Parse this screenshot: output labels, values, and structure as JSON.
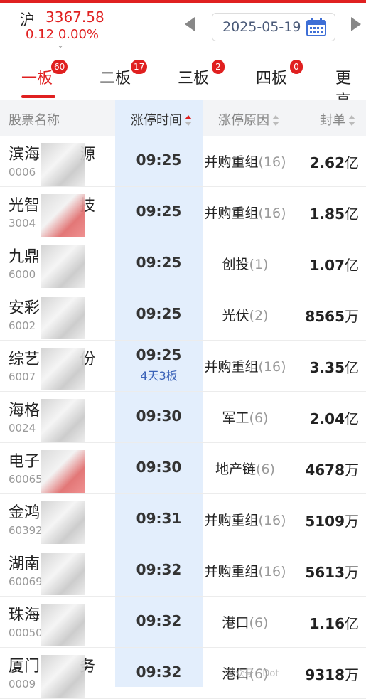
{
  "index": {
    "name": "沪",
    "value": "3367.58",
    "change": "0.12",
    "change_pct": "0.00%",
    "color": "#e02020"
  },
  "date": {
    "value": "2025-05-19"
  },
  "tabs": [
    {
      "label": "一板",
      "badge": "60",
      "active": true
    },
    {
      "label": "二板",
      "badge": "17"
    },
    {
      "label": "三板",
      "badge": "2"
    },
    {
      "label": "四板",
      "badge": "0"
    },
    {
      "label": "更高"
    }
  ],
  "columns": {
    "name": "股票名称",
    "time": "涨停时间",
    "reason": "涨停原因",
    "seal": "封单"
  },
  "rows": [
    {
      "name": "滨海",
      "name_tail": "源",
      "code": "0006",
      "time": "09:25",
      "reason": "并购重组",
      "reason_count": "(16)",
      "seal": "2.62",
      "seal_unit": "亿"
    },
    {
      "name": "光智",
      "name_tail": "技",
      "code": "3004",
      "time": "09:25",
      "reason": "并购重组",
      "reason_count": "(16)",
      "seal": "1.85",
      "seal_unit": "亿"
    },
    {
      "name": "九鼎",
      "name_tail": "",
      "code": "6000",
      "time": "09:25",
      "reason": "创投",
      "reason_count": "(1)",
      "seal": "1.07",
      "seal_unit": "亿"
    },
    {
      "name": "安彩",
      "name_tail": "",
      "code": "6002",
      "time": "09:25",
      "reason": "光伏",
      "reason_count": "(2)",
      "seal": "8565",
      "seal_unit": "万"
    },
    {
      "name": "综艺",
      "name_tail": "份",
      "code": "6007",
      "time": "09:25",
      "streak": "4天3板",
      "reason": "并购重组",
      "reason_count": "(16)",
      "seal": "3.35",
      "seal_unit": "亿"
    },
    {
      "name": "海格",
      "name_tail": "",
      "code": "0024",
      "time": "09:30",
      "reason": "军工",
      "reason_count": "(6)",
      "seal": "2.04",
      "seal_unit": "亿"
    },
    {
      "name": "电子",
      "name_tail": "",
      "code": "60065",
      "time": "09:30",
      "reason": "地产链",
      "reason_count": "(6)",
      "seal": "4678",
      "seal_unit": "万"
    },
    {
      "name": "金鸿",
      "name_tail": "",
      "code": "60392",
      "time": "09:31",
      "reason": "并购重组",
      "reason_count": "(16)",
      "seal": "5109",
      "seal_unit": "万"
    },
    {
      "name": "湖南",
      "name_tail": "",
      "code": "60069",
      "time": "09:32",
      "reason": "并购重组",
      "reason_count": "(16)",
      "seal": "5613",
      "seal_unit": "万"
    },
    {
      "name": "珠海",
      "name_tail": "",
      "code": "00050",
      "time": "09:32",
      "reason": "港口",
      "reason_count": "(6)",
      "seal": "1.16",
      "seal_unit": "亿"
    },
    {
      "name": "厦门",
      "name_tail": "务",
      "code": "0009",
      "time": "09:32",
      "reason": "港口",
      "reason_count": "(6)",
      "seal": "9318",
      "seal_unit": "万"
    }
  ],
  "watermark": "公众号 · Dot"
}
